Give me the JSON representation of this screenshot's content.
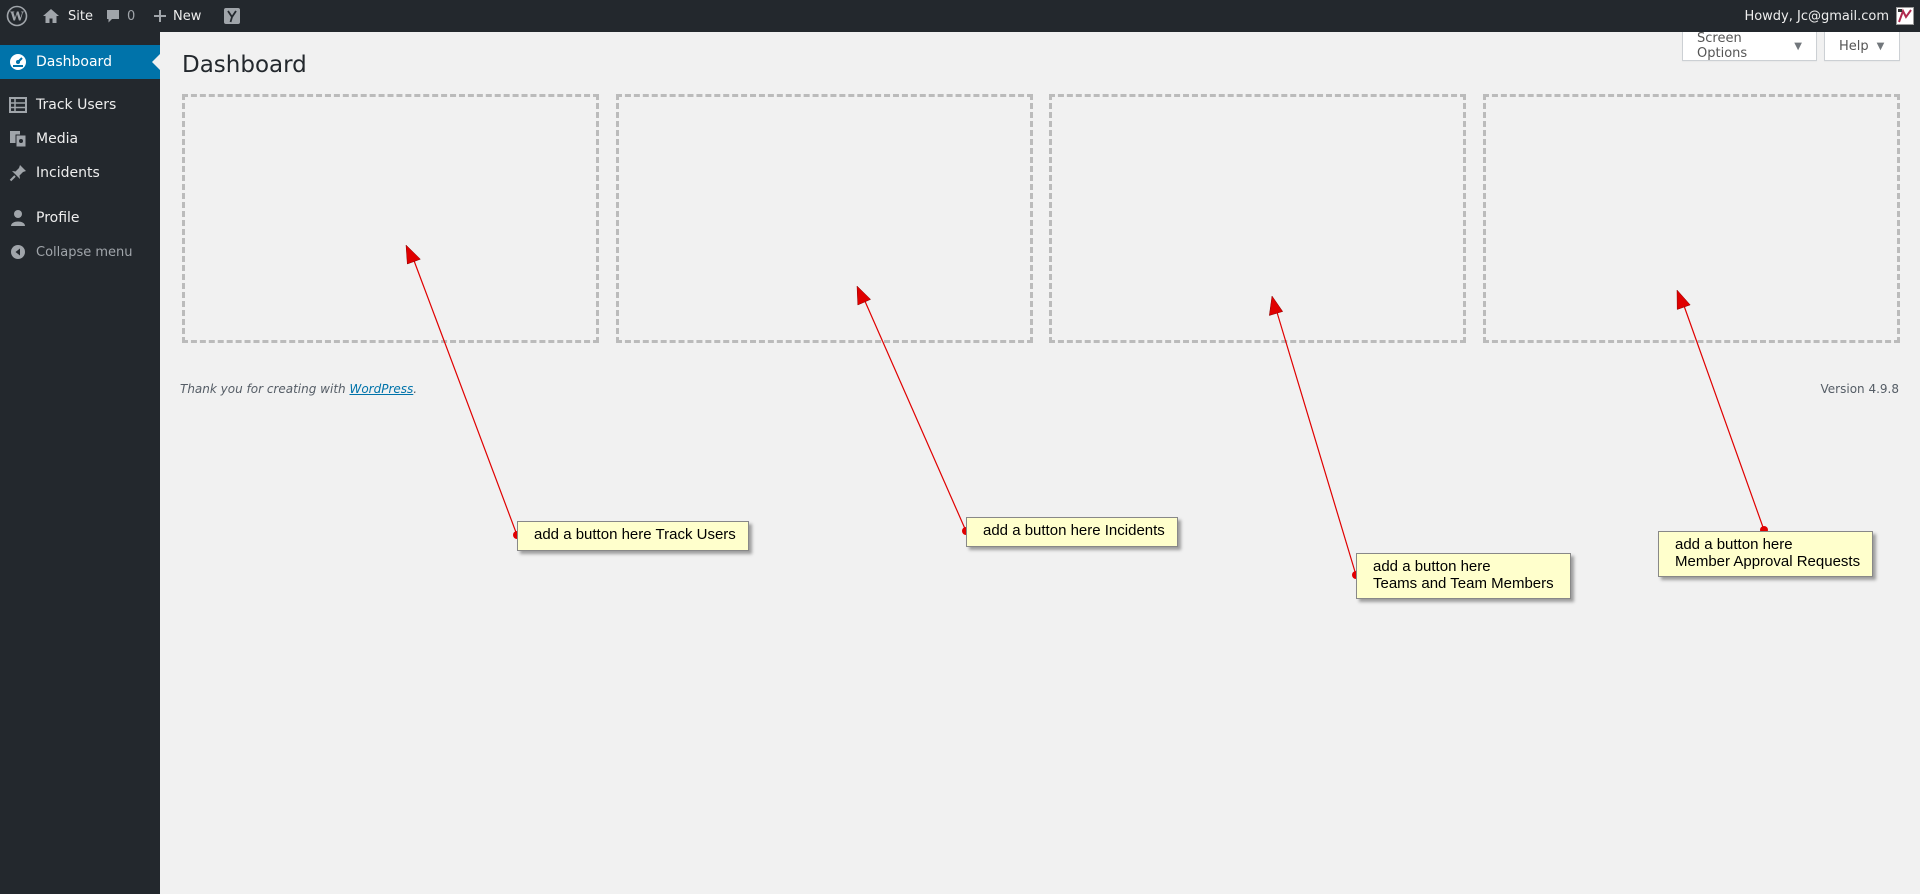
{
  "adminbar": {
    "site_label": "Site",
    "comments_count": "0",
    "new_label": "New",
    "howdy": "Howdy, Jc@gmail.com"
  },
  "sidebar": {
    "items": [
      {
        "label": "Dashboard",
        "icon": "dashboard-icon",
        "current": true
      },
      {
        "label": "Track Users",
        "icon": "table-icon"
      },
      {
        "label": "Media",
        "icon": "media-icon"
      },
      {
        "label": "Incidents",
        "icon": "pin-icon"
      },
      {
        "label": "Profile",
        "icon": "user-icon"
      }
    ],
    "collapse_label": "Collapse menu"
  },
  "main": {
    "title": "Dashboard",
    "screen_options_label": "Screen Options",
    "help_label": "Help"
  },
  "footer": {
    "thanks_prefix": "Thank you for creating with ",
    "wordpress_link": "WordPress",
    "thanks_suffix": ".",
    "version": "Version 4.9.8"
  },
  "annotations": [
    {
      "text": "add a button here Track Users"
    },
    {
      "text": "add a button here Incidents"
    },
    {
      "text": "add a button here\nTeams and Team Members"
    },
    {
      "text": "add a button here\nMember Approval Requests"
    }
  ],
  "colors": {
    "adminbar_bg": "#23282d",
    "accent": "#0073aa",
    "page_bg": "#f1f1f1",
    "note_bg": "#ffffcc",
    "arrow": "#e00000"
  }
}
